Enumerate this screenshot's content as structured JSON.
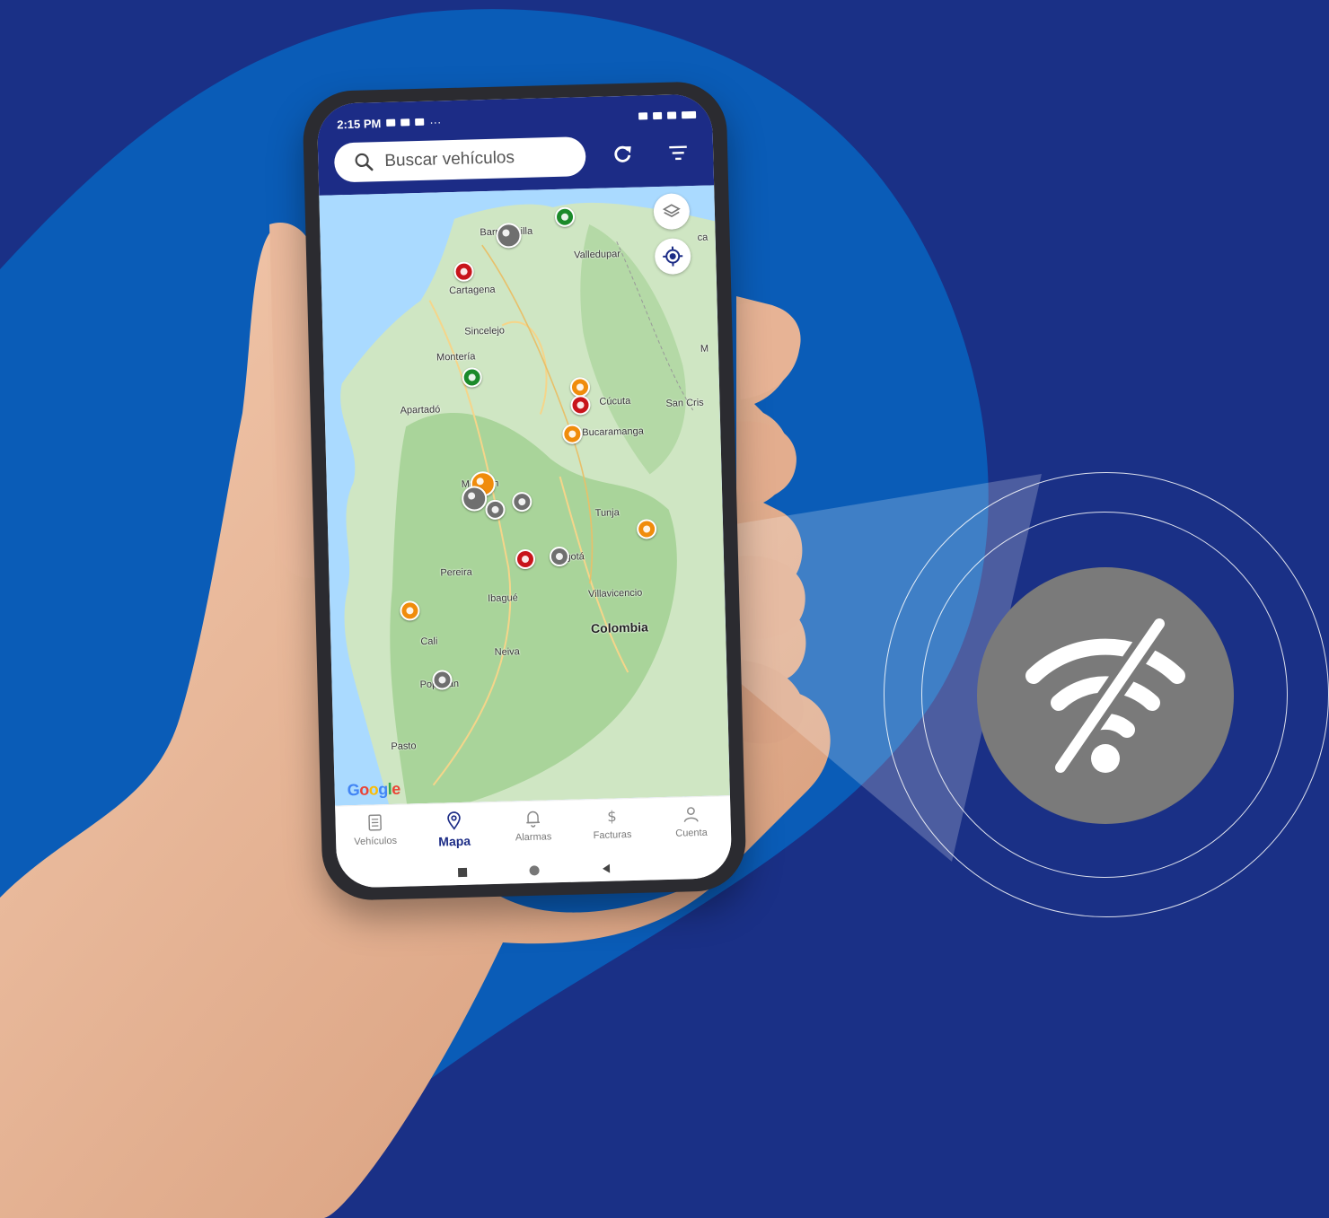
{
  "status_bar": {
    "time": "2:15 PM",
    "dots": "···"
  },
  "search": {
    "placeholder": "Buscar vehículos"
  },
  "map": {
    "cities": {
      "barranquilla": "Barranquilla",
      "valledupar": "Valledupar",
      "cartagena": "Cartagena",
      "sincelejo": "Sincelejo",
      "monteria": "Montería",
      "apartado": "Apartadó",
      "cucuta": "Cúcuta",
      "san_cristobal": "San Cris",
      "bucaramanga": "Bucaramanga",
      "medellin": "Medellín",
      "tunja": "Tunja",
      "pereira": "Pereira",
      "bogota": "Bogotá",
      "ibague": "Ibagué",
      "villavicencio": "Villavicencio",
      "colombia": "Colombia",
      "cali": "Cali",
      "neiva": "Neiva",
      "popayan": "Popayán",
      "pasto": "Pasto",
      "maracaibo": "M",
      "caracas_partial": "ca"
    },
    "google_logo": "Google",
    "pin_colors": {
      "red": "#c8141b",
      "green": "#1b8a2a",
      "orange": "#f08c0c",
      "gray": "#6f6f6f"
    }
  },
  "bottom_nav": [
    {
      "label": "Vehículos",
      "icon": "list-icon",
      "active": false
    },
    {
      "label": "Mapa",
      "icon": "map-pin-icon",
      "active": true
    },
    {
      "label": "Alarmas",
      "icon": "bell-icon",
      "active": false
    },
    {
      "label": "Facturas",
      "icon": "dollar-icon",
      "active": false
    },
    {
      "label": "Cuenta",
      "icon": "user-icon",
      "active": false
    }
  ],
  "callout": {
    "icon": "wifi-off-icon",
    "badge_color": "#7a7a7a"
  },
  "colors": {
    "background": "#1a3086",
    "blob": "#0a5cb7",
    "appbar": "#1c2c86"
  }
}
